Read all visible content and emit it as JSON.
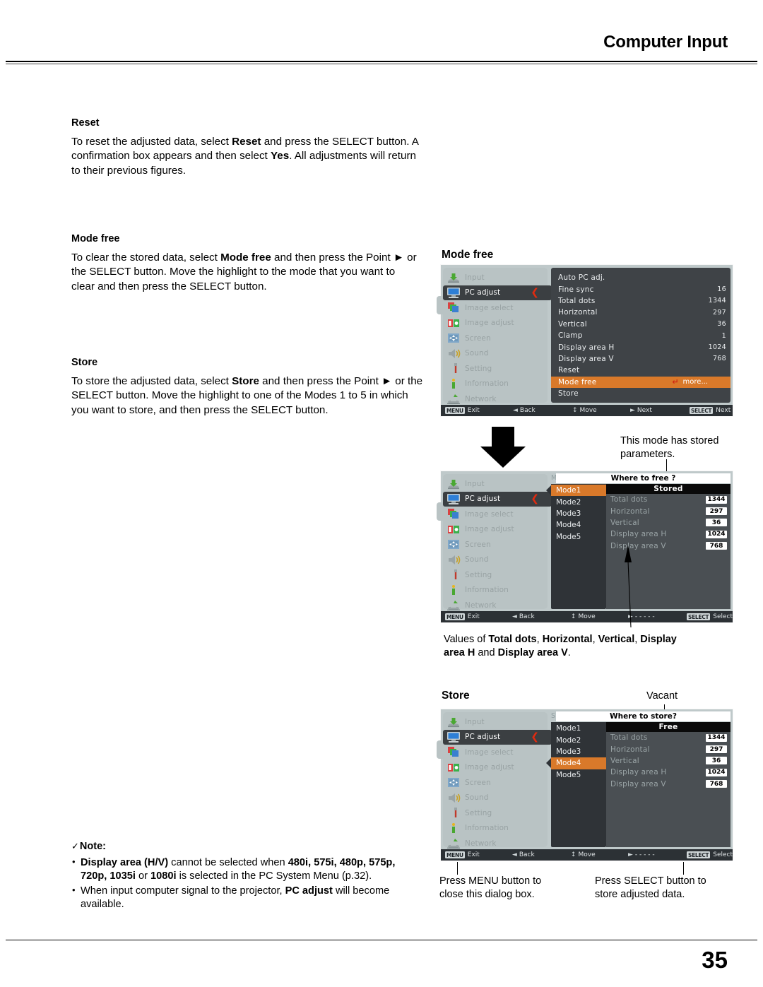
{
  "header": {
    "title": "Computer Input"
  },
  "footer": {
    "page_number": "35"
  },
  "left_column": {
    "reset": {
      "heading": "Reset",
      "paragraph_html": "To reset the adjusted data, select <b>Reset</b> and press the SELECT button. A confirmation box appears and then select <b>Yes</b>. All adjustments will return to their previous figures."
    },
    "mode_free": {
      "heading": "Mode free",
      "paragraph_html": "To clear the stored data, select <b>Mode free</b> and then press the Point ► or the SELECT button. Move the highlight to the mode that you want to clear and then press the SELECT button."
    },
    "store": {
      "heading": "Store",
      "paragraph_html": "To store the adjusted data, select <b>Store</b> and then press the Point ► or the SELECT button. Move the highlight to one of the Modes 1 to 5 in which you want to store, and then press the SELECT button."
    },
    "note": {
      "check_glyph": "✓",
      "title": "Note:",
      "items_html": [
        "<b>Display area (H/V)</b> cannot be selected when <b>480i, 575i, 480p, 575p, 720p, 1035i</b> or <b>1080i</b> is selected in the PC System Menu (p.32).",
        "When input computer signal to the projector, <b>PC adjust</b> will become available."
      ]
    }
  },
  "osd": {
    "colors": {
      "highlight": "#d9792a",
      "selected_row": "#3b3f42",
      "arrow_red": "#e02b10",
      "panel": "#3f4347",
      "shell": "#bfc9ca"
    },
    "sidebar_items": [
      {
        "label": "Input",
        "icon": "input-icon",
        "state": "dim"
      },
      {
        "label": "PC adjust",
        "icon": "pc-adjust-icon",
        "state": "selected"
      },
      {
        "label": "Image select",
        "icon": "image-select-icon",
        "state": "dim"
      },
      {
        "label": "Image adjust",
        "icon": "image-adjust-icon",
        "state": "dim"
      },
      {
        "label": "Screen",
        "icon": "screen-icon",
        "state": "dim"
      },
      {
        "label": "Sound",
        "icon": "sound-icon",
        "state": "dim"
      },
      {
        "label": "Setting",
        "icon": "setting-icon",
        "state": "dim"
      },
      {
        "label": "Information",
        "icon": "information-icon",
        "state": "dim"
      },
      {
        "label": "Network",
        "icon": "network-icon",
        "state": "dim"
      }
    ],
    "guide_bar": [
      {
        "key": "MENU",
        "label": "Exit"
      },
      {
        "glyph": "◄",
        "label": "Back"
      },
      {
        "glyph": "↕",
        "label": "Move"
      },
      {
        "glyph": "►",
        "label": "Next"
      },
      {
        "key": "SELECT",
        "label": "Next"
      }
    ],
    "guide_bar_dialog": [
      {
        "key": "MENU",
        "label": "Exit"
      },
      {
        "glyph": "◄",
        "label": "Back"
      },
      {
        "glyph": "↕",
        "label": "Move"
      },
      {
        "glyph": "►",
        "label": "- - - - -"
      },
      {
        "key": "SELECT",
        "label": "Select"
      }
    ]
  },
  "screen_1": {
    "caption": "Mode free",
    "menu_rows": [
      {
        "name": "Auto PC adj.",
        "value": ""
      },
      {
        "name": "Fine sync",
        "value": "16"
      },
      {
        "name": "Total dots",
        "value": "1344"
      },
      {
        "name": "Horizontal",
        "value": "297"
      },
      {
        "name": "Vertical",
        "value": "36"
      },
      {
        "name": "Clamp",
        "value": "1"
      },
      {
        "name": "Display area H",
        "value": "1024"
      },
      {
        "name": "Display area V",
        "value": "768"
      },
      {
        "name": "Reset",
        "value": ""
      },
      {
        "name": "Mode free",
        "value": "more...",
        "highlight": true,
        "return_glyph": "↵"
      },
      {
        "name": "Store",
        "value": ""
      }
    ]
  },
  "screen_2": {
    "dialog_title": "Mode free",
    "question": "Where to free ?",
    "status": "Stored",
    "modes": [
      {
        "label": "Mode1",
        "selected": true
      },
      {
        "label": "Mode2",
        "selected": false
      },
      {
        "label": "Mode3",
        "selected": false
      },
      {
        "label": "Mode4",
        "selected": false
      },
      {
        "label": "Mode5",
        "selected": false
      }
    ],
    "values": [
      {
        "name": "Total dots",
        "value": "1344"
      },
      {
        "name": "Horizontal",
        "value": "297"
      },
      {
        "name": "Vertical",
        "value": "36"
      },
      {
        "name": "Display area H",
        "value": "1024"
      },
      {
        "name": "Display area V",
        "value": "768"
      }
    ],
    "callout_stored": "This mode has stored parameters.",
    "callout_values_html": "Values of <b>Total dots</b>, <b>Horizontal</b>, <b>Vertical</b>, <b>Display area H</b> and <b>Display area V</b>."
  },
  "screen_3": {
    "caption": "Store",
    "dialog_title": "Store",
    "question": "Where to store?",
    "status": "Free",
    "callout_vacant": "Vacant",
    "modes": [
      {
        "label": "Mode1",
        "selected": false
      },
      {
        "label": "Mode2",
        "selected": false
      },
      {
        "label": "Mode3",
        "selected": false
      },
      {
        "label": "Mode4",
        "selected": true
      },
      {
        "label": "Mode5",
        "selected": false
      }
    ],
    "values": [
      {
        "name": "Total dots",
        "value": "1344"
      },
      {
        "name": "Horizontal",
        "value": "297"
      },
      {
        "name": "Vertical",
        "value": "36"
      },
      {
        "name": "Display area H",
        "value": "1024"
      },
      {
        "name": "Display area V",
        "value": "768"
      }
    ],
    "callout_menu": "Press MENU button to close this dialog box.",
    "callout_select": "Press SELECT button to store adjusted data."
  }
}
